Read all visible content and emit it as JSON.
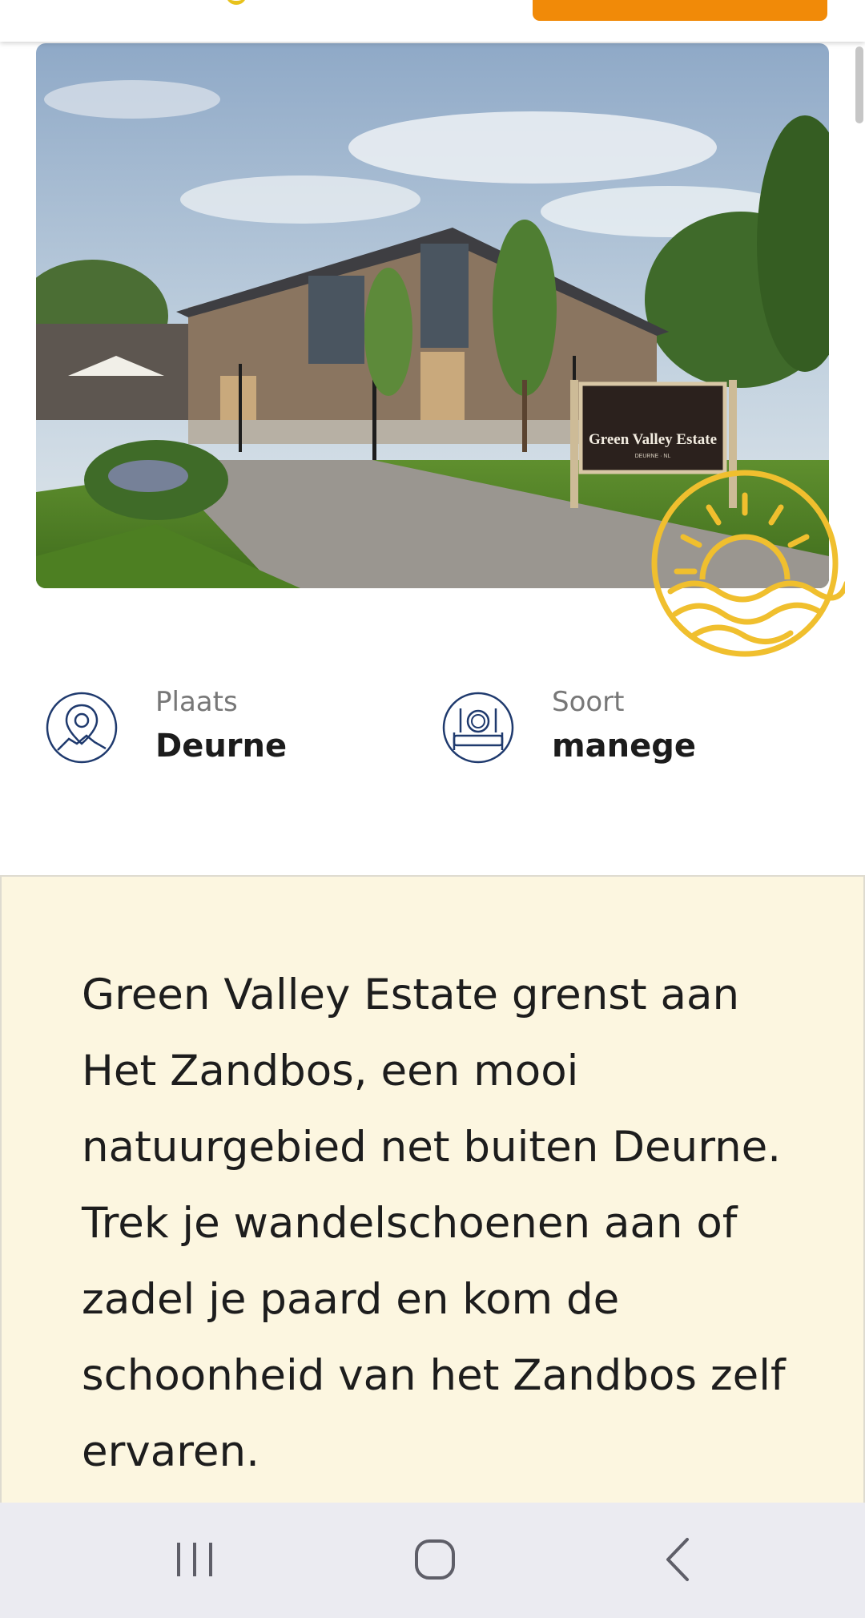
{
  "hero": {
    "sign_text": "Green Valley Estate",
    "sign_subtext": "DEURNE · NL"
  },
  "info": [
    {
      "label": "Plaats",
      "value": "Deurne",
      "icon": "map-pin-icon"
    },
    {
      "label": "Soort",
      "value": "manege",
      "icon": "dining-bed-icon"
    }
  ],
  "description": "Green Valley Estate grenst aan Het Zandbos, een mooi natuurgebied net buiten Deurne. Trek je wandelschoenen aan of zadel je paard en kom de schoonheid van het Zandbos zelf ervaren.",
  "navbar": {
    "buttons": [
      "recent-apps-icon",
      "home-icon",
      "back-icon"
    ]
  },
  "colors": {
    "accent_orange": "#f18a08",
    "sun_yellow": "#f0bf2e",
    "icon_navy": "#1f3a6e",
    "panel_cream": "#fcf6e0"
  }
}
